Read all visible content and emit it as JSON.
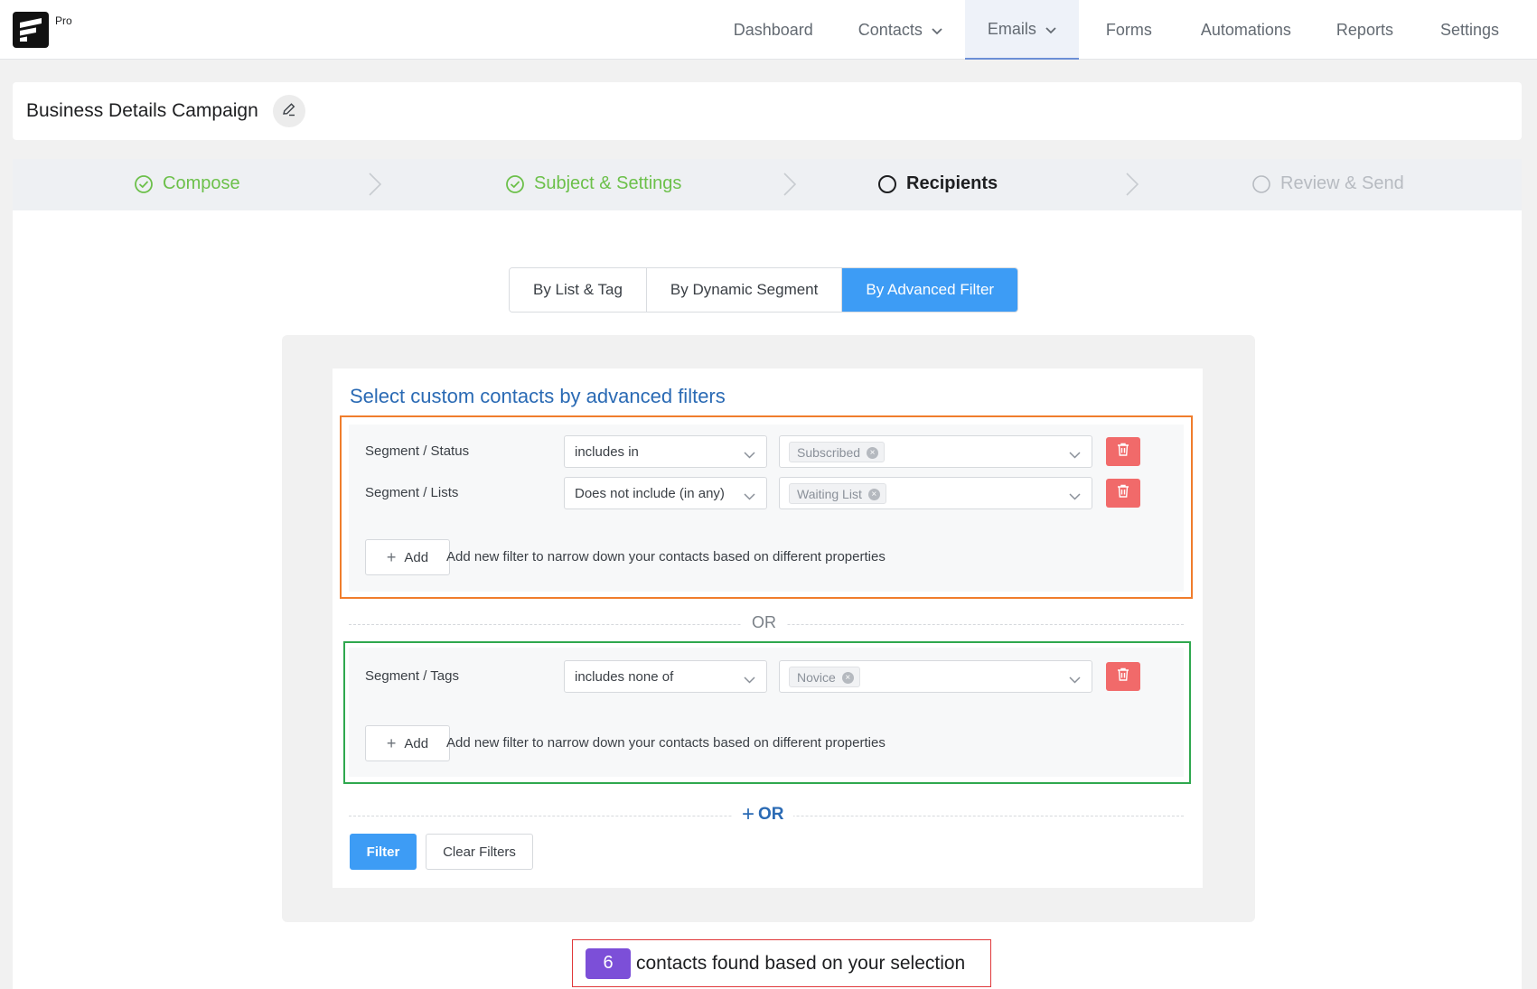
{
  "header": {
    "logo_badge": "Pro",
    "nav": [
      {
        "label": "Dashboard",
        "has_dropdown": false
      },
      {
        "label": "Contacts",
        "has_dropdown": true
      },
      {
        "label": "Emails",
        "has_dropdown": true,
        "active": true
      },
      {
        "label": "Forms",
        "has_dropdown": false
      },
      {
        "label": "Automations",
        "has_dropdown": false
      },
      {
        "label": "Reports",
        "has_dropdown": false
      },
      {
        "label": "Settings",
        "has_dropdown": false
      }
    ]
  },
  "campaign": {
    "title": "Business Details Campaign",
    "edit_icon": "pencil-icon"
  },
  "steps": [
    {
      "label": "Compose",
      "state": "done"
    },
    {
      "label": "Subject & Settings",
      "state": "done"
    },
    {
      "label": "Recipients",
      "state": "current"
    },
    {
      "label": "Review & Send",
      "state": "pending"
    }
  ],
  "recipient_tabs": [
    {
      "label": "By List & Tag",
      "active": false
    },
    {
      "label": "By Dynamic Segment",
      "active": false
    },
    {
      "label": "By Advanced Filter",
      "active": true
    }
  ],
  "filters": {
    "heading": "Select custom contacts by advanced filters",
    "groups": [
      {
        "rows": [
          {
            "property": "Segment / Status",
            "operator": "includes in",
            "values": [
              "Subscribed"
            ]
          },
          {
            "property": "Segment / Lists",
            "operator": "Does not include (in any)",
            "values": [
              "Waiting List"
            ]
          }
        ],
        "add_label": "Add",
        "add_hint": "Add new filter to narrow down your contacts based on different properties"
      },
      {
        "rows": [
          {
            "property": "Segment / Tags",
            "operator": "includes none of",
            "values": [
              "Novice"
            ]
          }
        ],
        "add_label": "Add",
        "add_hint": "Add new filter to narrow down your contacts based on different properties"
      }
    ],
    "or_separator": "OR",
    "add_or_label": "OR",
    "filter_button": "Filter",
    "clear_button": "Clear Filters"
  },
  "result": {
    "count": "6",
    "text": "contacts found based on your selection"
  },
  "colors": {
    "primary": "#3d9cf5",
    "done": "#6cc04a",
    "danger": "#f16a6a",
    "heading_blue": "#2a6ab4",
    "count_badge": "#7c4fd8",
    "group1_outline": "#f07d2c",
    "group2_outline": "#2fa84e",
    "result_outline": "#e0373a"
  }
}
